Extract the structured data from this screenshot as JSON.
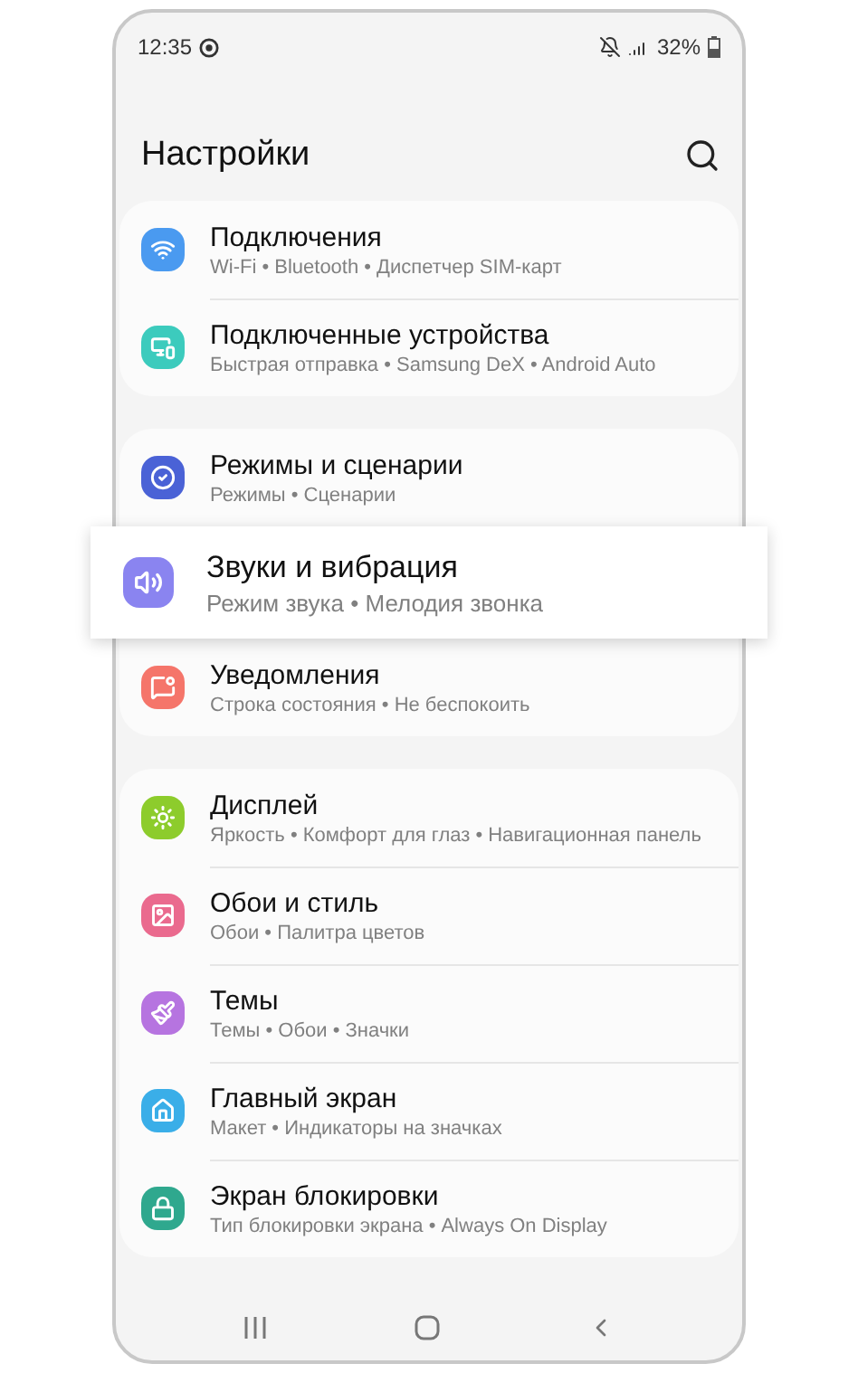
{
  "status_bar": {
    "time": "12:35",
    "battery": "32%"
  },
  "header": {
    "title": "Настройки"
  },
  "groups": [
    {
      "items": [
        {
          "title": "Подключения",
          "subtitle": "Wi-Fi • Bluetooth • Диспетчер SIM-карт",
          "color": "#4a9af0",
          "highlighted": false
        },
        {
          "title": "Подключенные устройства",
          "subtitle": "Быстрая отправка • Samsung DeX • Android Auto",
          "color": "#3ccbbd",
          "highlighted": false
        }
      ]
    },
    {
      "items": [
        {
          "title": "Режимы и сценарии",
          "subtitle": "Режимы • Сценарии",
          "color": "#4a62d6",
          "highlighted": false
        },
        {
          "title": "Звуки и вибрация",
          "subtitle": "Режим звука • Мелодия звонка",
          "color": "#8a84f0",
          "highlighted": true
        },
        {
          "title": "Уведомления",
          "subtitle": "Строка состояния • Не беспокоить",
          "color": "#f5756a",
          "highlighted": false
        }
      ]
    },
    {
      "items": [
        {
          "title": "Дисплей",
          "subtitle": "Яркость • Комфорт для глаз • Навигационная панель",
          "color": "#8dcc2c",
          "highlighted": false
        },
        {
          "title": "Обои и стиль",
          "subtitle": "Обои • Палитра цветов",
          "color": "#ea6a8e",
          "highlighted": false
        },
        {
          "title": "Темы",
          "subtitle": "Темы • Обои • Значки",
          "color": "#b674e0",
          "highlighted": false
        },
        {
          "title": "Главный экран",
          "subtitle": "Макет • Индикаторы на значках",
          "color": "#3aaee8",
          "highlighted": false
        },
        {
          "title": "Экран блокировки",
          "subtitle": "Тип блокировки экрана • Always On Display",
          "color": "#2fa88e",
          "highlighted": false
        }
      ]
    }
  ]
}
